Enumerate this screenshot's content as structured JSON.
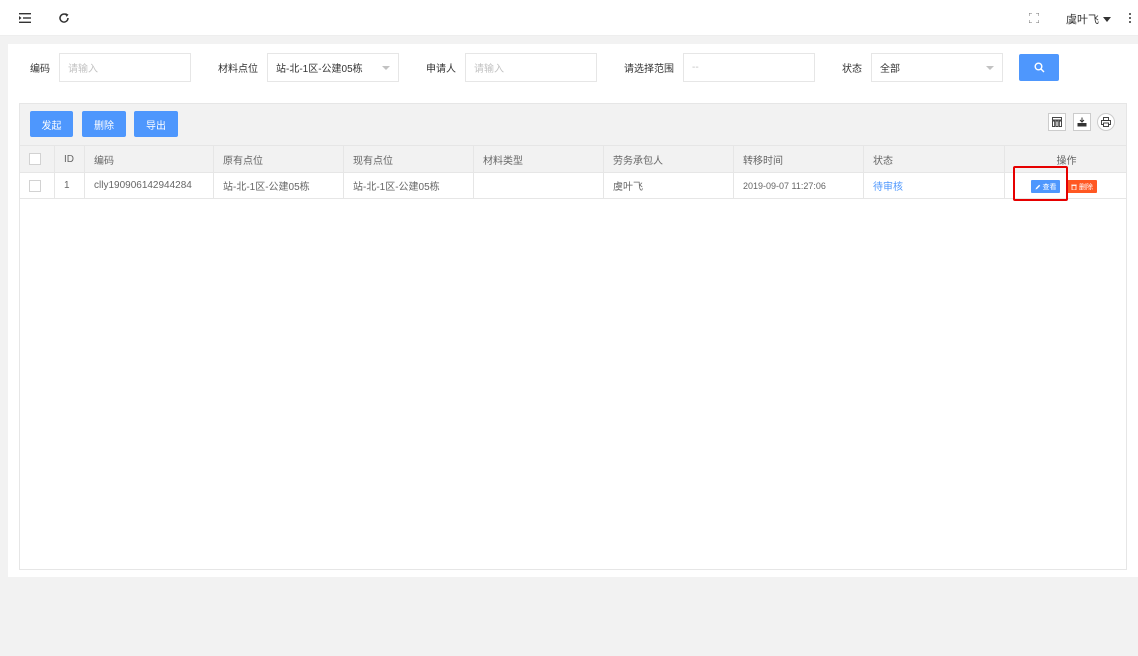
{
  "header": {
    "menu_icon": "menu-fold-icon",
    "refresh_icon": "refresh-icon",
    "fullscreen_icon": "fullscreen-icon",
    "user_name": "虞叶飞",
    "more_icon": "more-vertical-icon"
  },
  "filters": {
    "code_label": "编码",
    "code_placeholder": "请输入",
    "location_label": "材料点位",
    "location_value": "站-北-1区-公建05栋",
    "applicant_label": "申请人",
    "applicant_placeholder": "请输入",
    "range_label": "请选择范围",
    "range_placeholder": "--",
    "status_label": "状态",
    "status_value": "全部"
  },
  "toolbar": {
    "initiate_label": "发起",
    "delete_label": "删除",
    "export_label": "导出"
  },
  "table": {
    "columns": [
      "ID",
      "编码",
      "原有点位",
      "现有点位",
      "材料类型",
      "劳务承包人",
      "转移时间",
      "状态",
      "操作"
    ],
    "rows": [
      {
        "id": "1",
        "code": "clly190906142944284",
        "original_location": "站-北-1区-公建05栋",
        "current_location": "站-北-1区-公建05栋",
        "material_type": "",
        "contractor": "虞叶飞",
        "transfer_time": "2019-09-07 11:27:06",
        "status": "待审核",
        "view_label": "查看",
        "delete_label": "删除"
      }
    ]
  },
  "colors": {
    "primary": "#4e97fd",
    "danger": "#ff5722",
    "highlight": "#e60000"
  }
}
